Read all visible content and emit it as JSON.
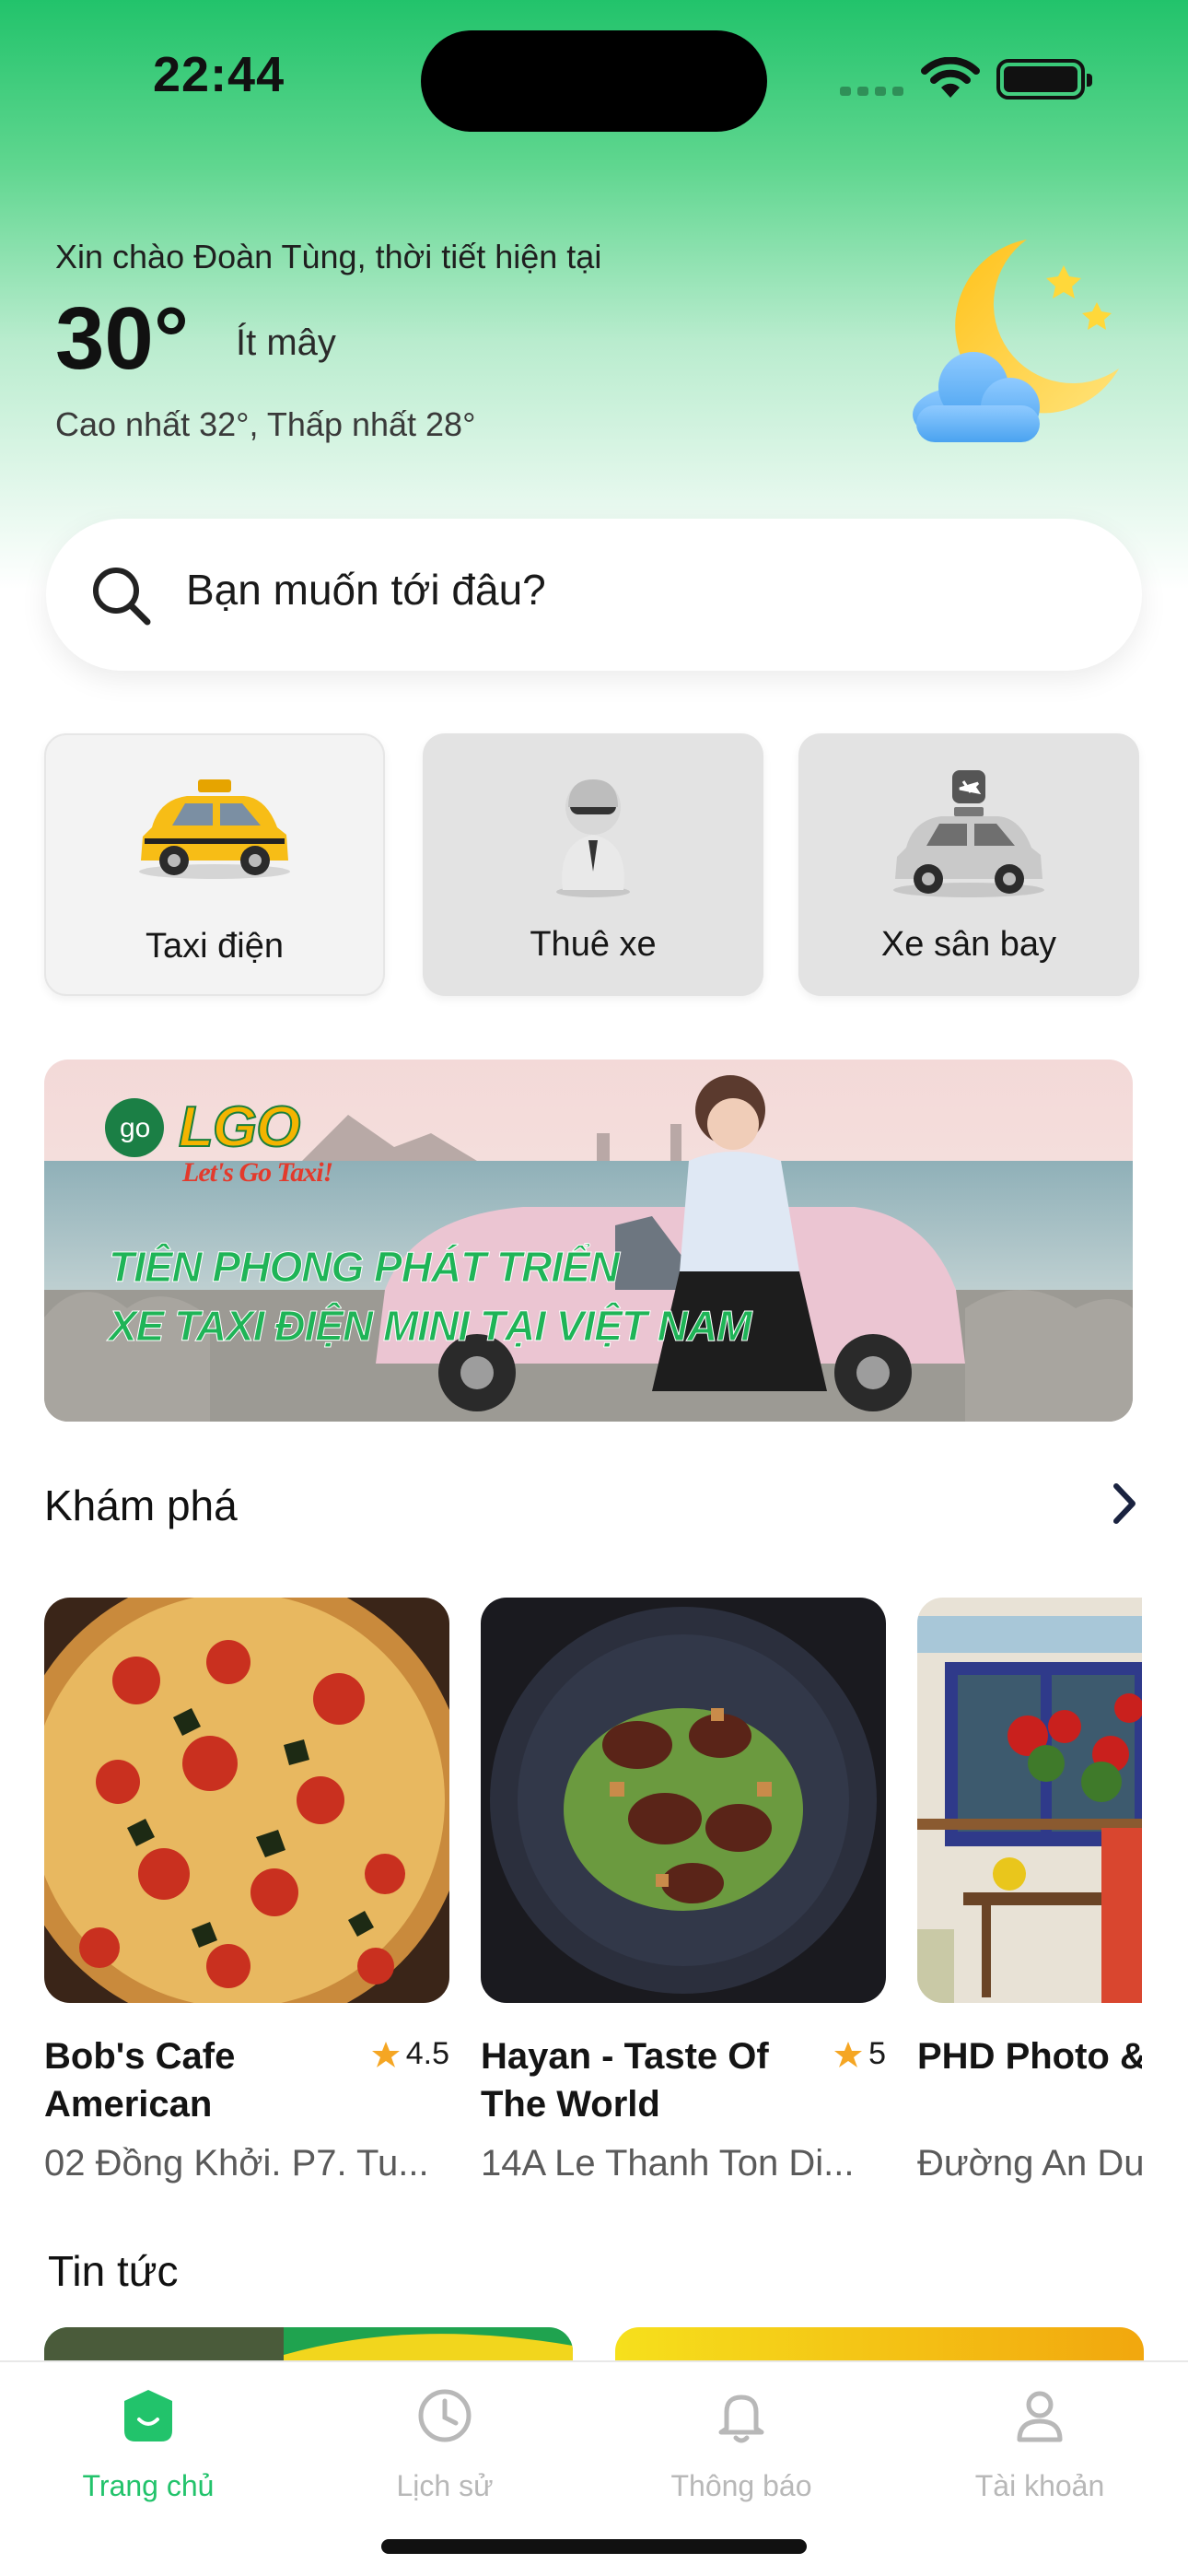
{
  "status_bar": {
    "time": "22:44"
  },
  "weather": {
    "greeting": "Xin chào Đoàn Tùng, thời tiết hiện tại",
    "temperature": "30°",
    "condition": "Ít mây",
    "high_low": "Cao nhất 32°, Thấp nhất 28°",
    "icon": "moon-cloud-icon"
  },
  "search": {
    "placeholder": "Bạn muốn tới đâu?",
    "icon": "search-icon"
  },
  "services": [
    {
      "label": "Taxi điện",
      "icon": "taxi-icon"
    },
    {
      "label": "Thuê xe",
      "icon": "driver-icon"
    },
    {
      "label": "Xe sân bay",
      "icon": "airport-car-icon"
    }
  ],
  "banner": {
    "brand": "LGO",
    "tagline": "Let's Go Taxi!",
    "headline_1": "TIÊN PHONG PHÁT TRIỂN",
    "headline_2": "XE TAXI ĐIỆN MINI TẠI VIỆT NAM"
  },
  "explore": {
    "title": "Khám phá",
    "items": [
      {
        "name": "Bob's Cafe American",
        "rating": "4.5",
        "address": "02 Đồng Khởi. P7. Tu..."
      },
      {
        "name": "Hayan - Taste Of The World",
        "rating": "5",
        "address": "14A Le Thanh Ton Di..."
      },
      {
        "name": "PHD Photo & Coffee",
        "rating": "",
        "address": "Đường An Du"
      }
    ]
  },
  "news": {
    "title": "Tin tức"
  },
  "tabbar": {
    "tabs": [
      {
        "label": "Trang chủ",
        "icon": "home-icon",
        "active": true
      },
      {
        "label": "Lịch sử",
        "icon": "clock-icon",
        "active": false
      },
      {
        "label": "Thông báo",
        "icon": "bell-icon",
        "active": false
      },
      {
        "label": "Tài khoản",
        "icon": "user-icon",
        "active": false
      }
    ]
  },
  "colors": {
    "brand_green": "#22c36b",
    "star": "#f5a623",
    "inactive": "#b8b8b8"
  }
}
